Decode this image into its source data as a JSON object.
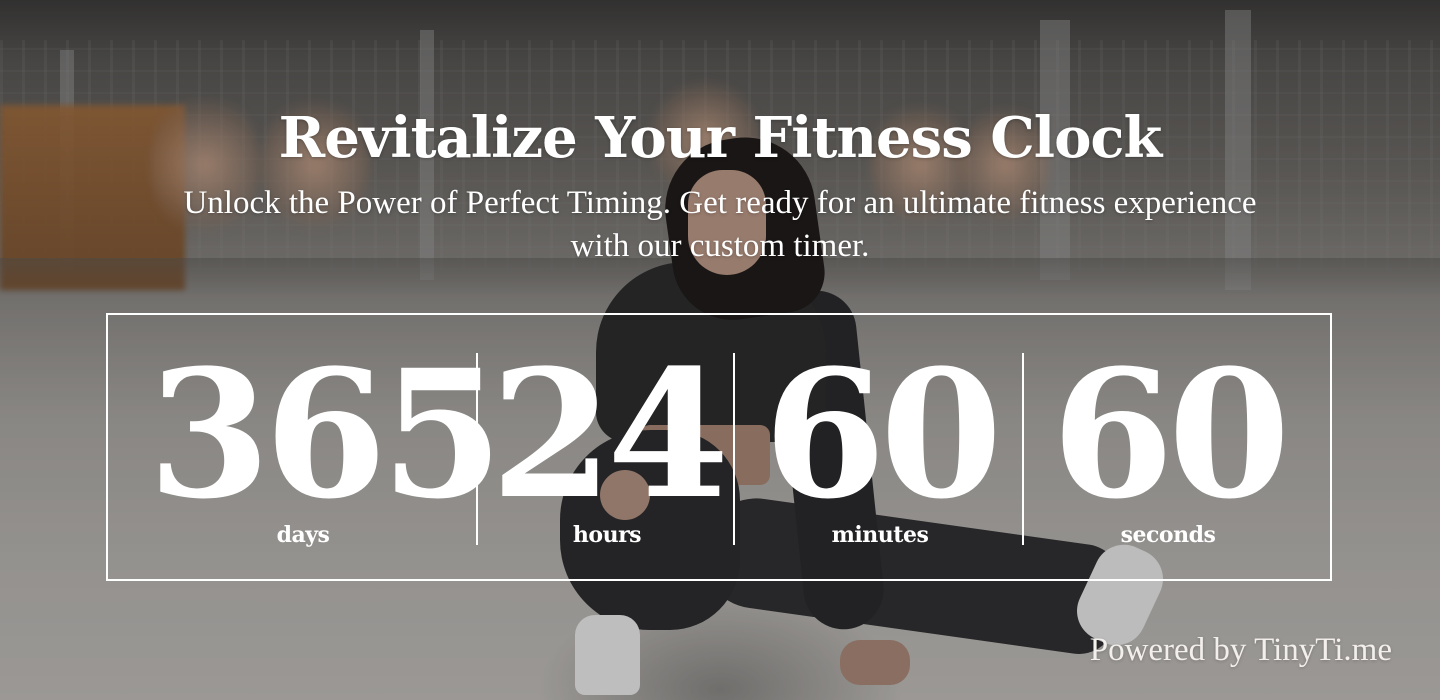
{
  "header": {
    "title": "Revitalize Your Fitness Clock",
    "subtitle": "Unlock the Power of Perfect Timing. Get ready for an ultimate fitness experience with our custom timer."
  },
  "countdown": {
    "days": {
      "value": "365",
      "label": "days"
    },
    "hours": {
      "value": "24",
      "label": "hours"
    },
    "minutes": {
      "value": "60",
      "label": "minutes"
    },
    "seconds": {
      "value": "60",
      "label": "seconds"
    }
  },
  "footer": {
    "powered_by": "Powered by TinyTi.me"
  },
  "colors": {
    "text": "#ffffff",
    "box_border": "#ffffff"
  }
}
